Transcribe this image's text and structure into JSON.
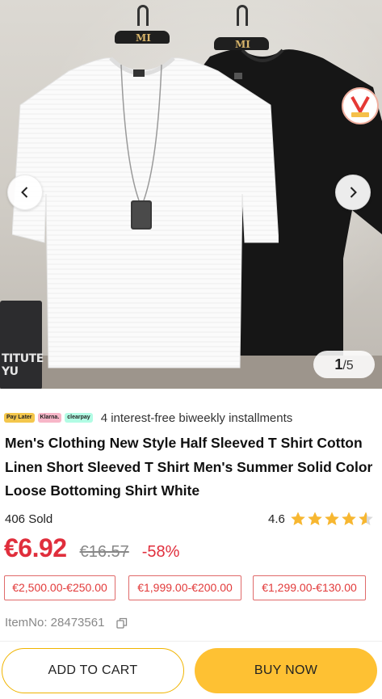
{
  "gallery": {
    "current_page": "1",
    "page_sep_total": "/5",
    "hanger_logo": "MI",
    "crate_text": "TITUTE\nYU"
  },
  "payments": {
    "chips": [
      "Pay Later",
      "Klarna.",
      "clearpay"
    ],
    "text": "4 interest-free biweekly installments"
  },
  "product": {
    "title": "Men's Clothing New Style Half Sleeved T Shirt Cotton Linen Short Sleeved T Shirt Men's Summer Solid Color Loose Bottoming Shirt White",
    "sold": "406 Sold",
    "rating": "4.6",
    "rating_value": 4.6,
    "price": "€6.92",
    "old_price": "€16.57",
    "discount": "-58%",
    "coupons": [
      "€2,500.00-€250.00",
      "€1,999.00-€200.00",
      "€1,299.00-€130.00"
    ],
    "item_no": "ItemNo: 28473561"
  },
  "actions": {
    "add_to_cart": "ADD TO CART",
    "buy_now": "BUY NOW"
  },
  "colors": {
    "price_red": "#e02e3c",
    "buy_yellow": "#fec133",
    "star_yellow": "#f7b731"
  }
}
